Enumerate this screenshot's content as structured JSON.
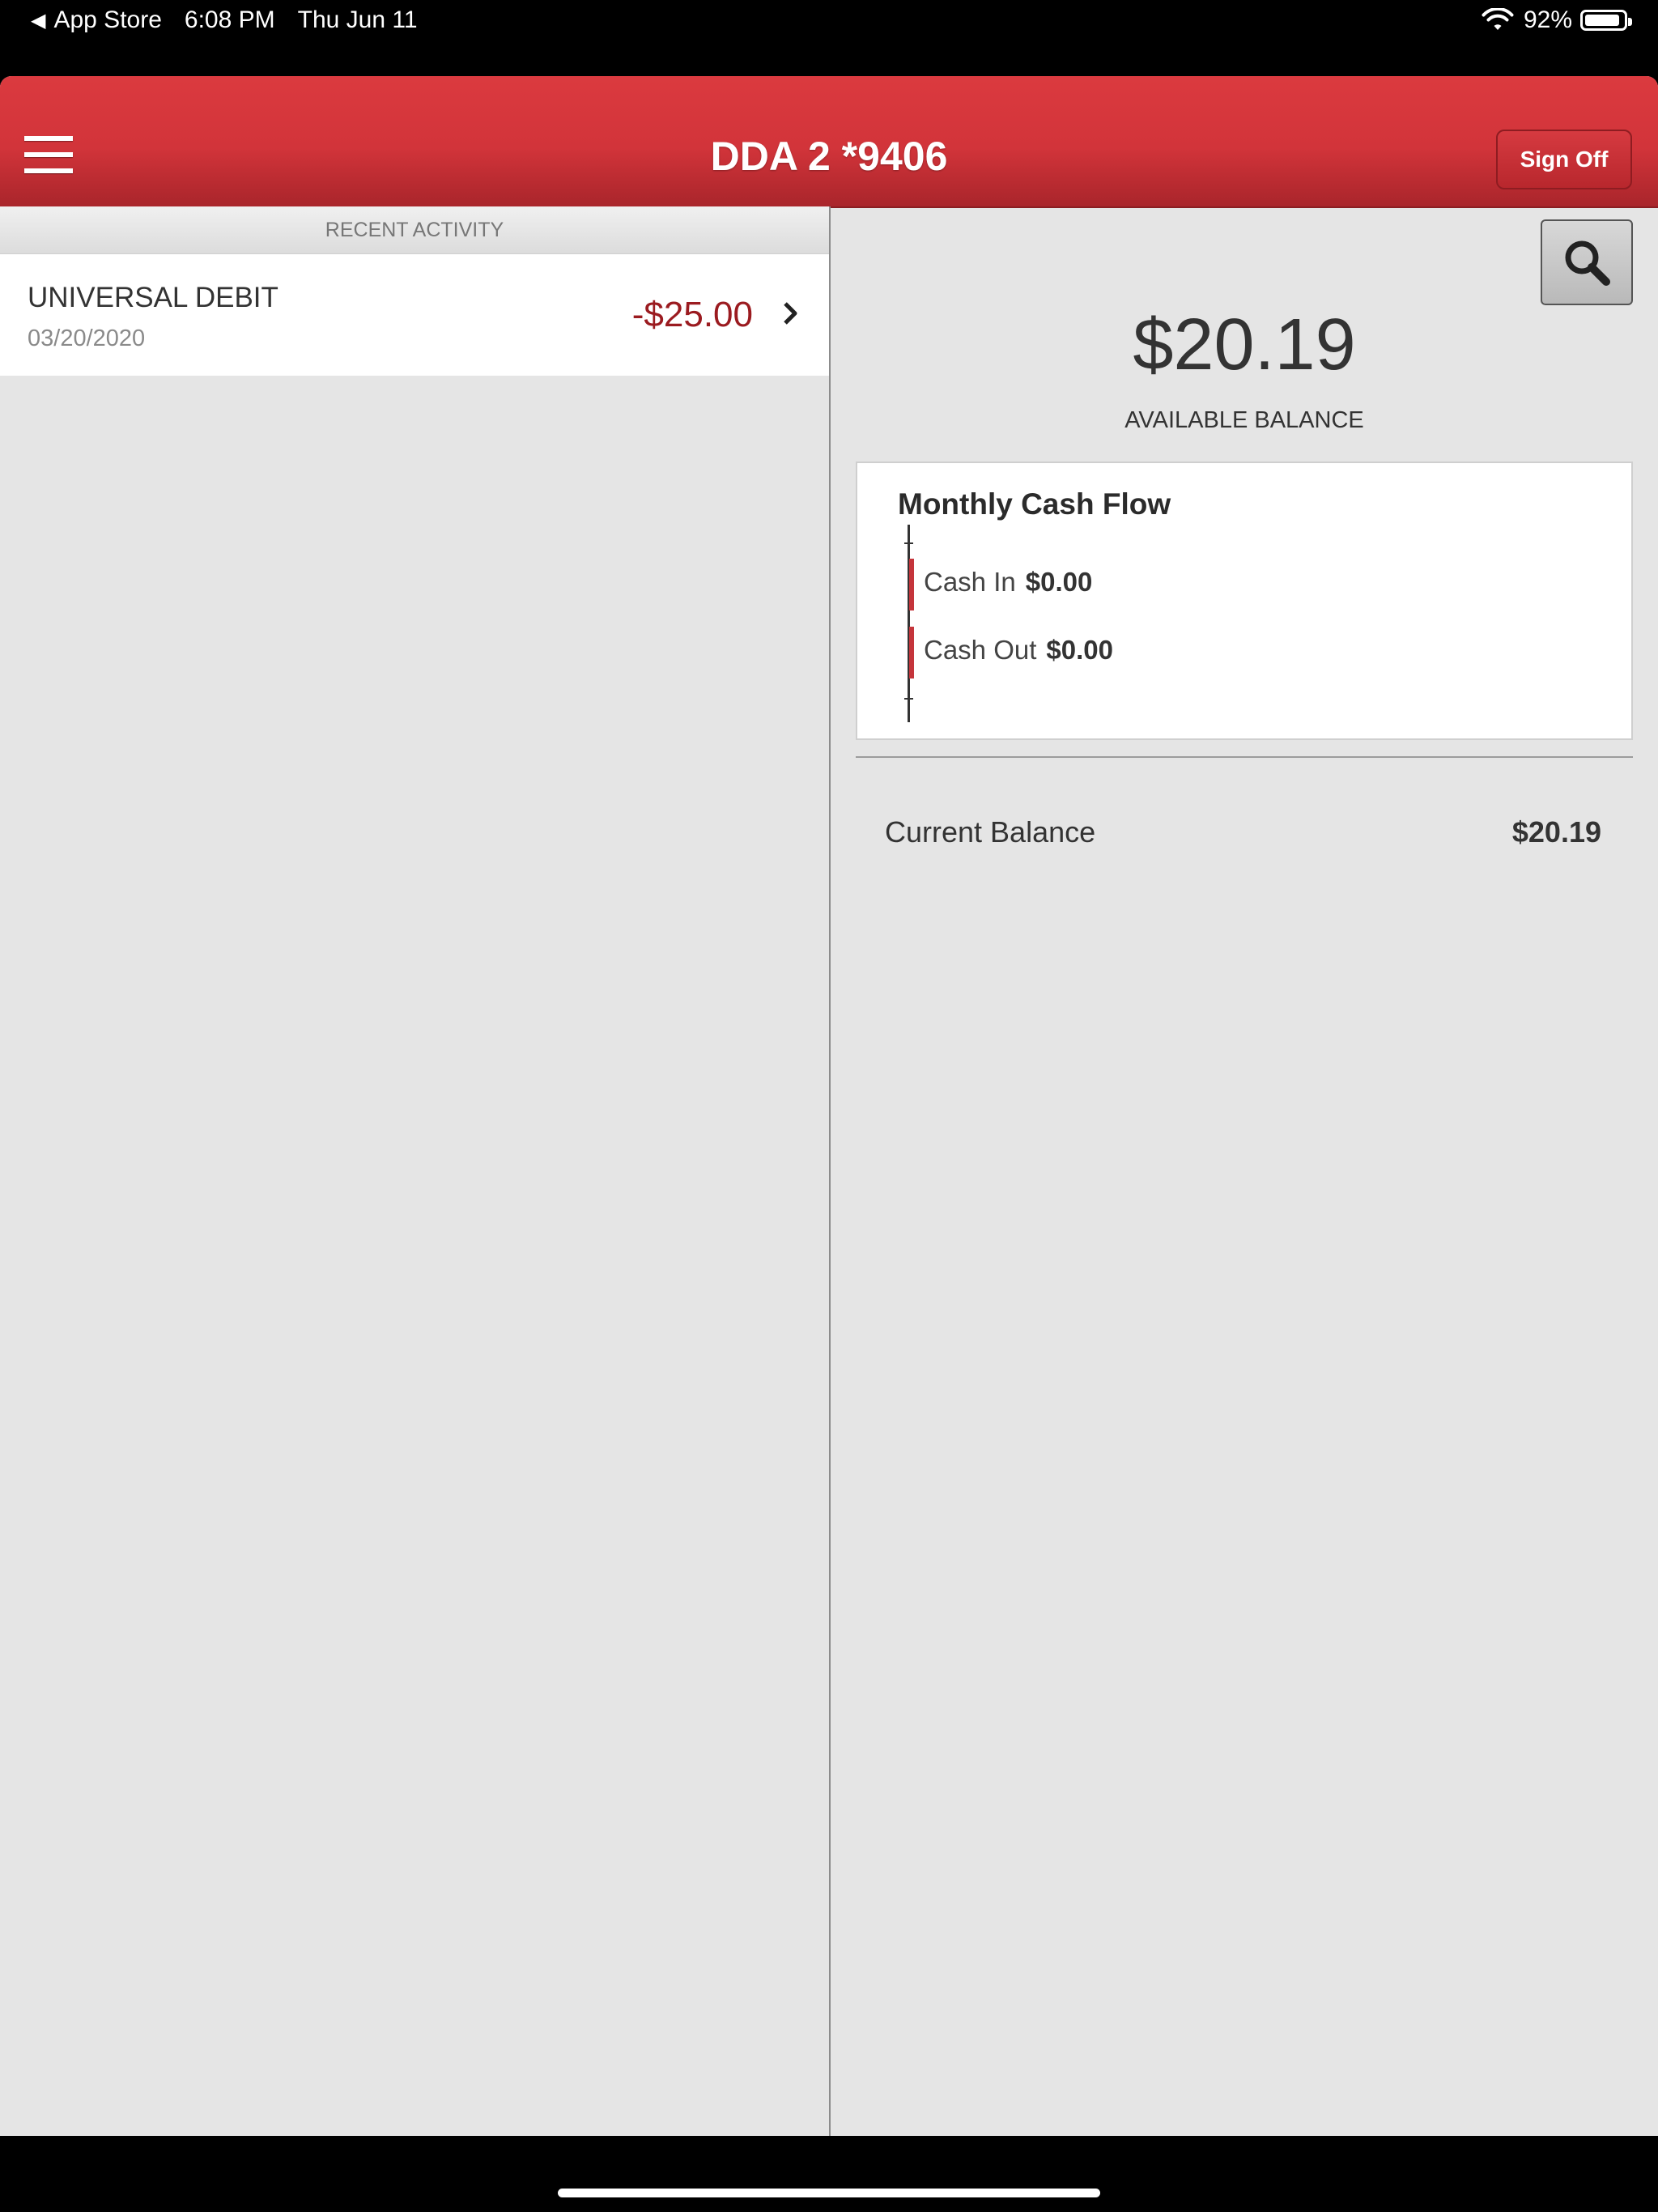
{
  "status_bar": {
    "back_label": "App Store",
    "time": "6:08 PM",
    "date": "Thu Jun 11",
    "battery_percent": "92%",
    "battery_level": 0.92,
    "icons": [
      "back-arrow-icon",
      "wifi-icon",
      "battery-icon"
    ]
  },
  "header": {
    "title": "DDA 2 *9406",
    "sign_off_label": "Sign Off",
    "brand_color": "#d2343a"
  },
  "recent_activity": {
    "heading": "RECENT ACTIVITY",
    "transactions": [
      {
        "name": "UNIVERSAL DEBIT",
        "date": "03/20/2020",
        "amount": "-$25.00",
        "amount_color": "#9b1b20"
      }
    ]
  },
  "account": {
    "available_balance": "$20.19",
    "available_balance_label": "AVAILABLE BALANCE",
    "current_balance_label": "Current Balance",
    "current_balance": "$20.19"
  },
  "cash_flow": {
    "title": "Monthly Cash Flow",
    "cash_in_label": "Cash In",
    "cash_in_value": "$0.00",
    "cash_out_label": "Cash Out",
    "cash_out_value": "$0.00"
  }
}
